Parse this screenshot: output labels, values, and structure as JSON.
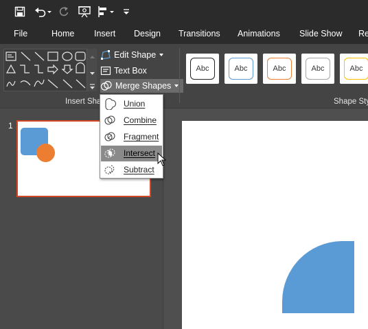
{
  "quick_access": {
    "icons": [
      "save-icon",
      "undo-icon",
      "redo-icon",
      "presentation-from-beginning-icon",
      "align-icon",
      "customize-qat-icon"
    ]
  },
  "tabs": [
    "File",
    "Home",
    "Insert",
    "Design",
    "Transitions",
    "Animations",
    "Slide Show",
    "Re"
  ],
  "ribbon": {
    "edit_shape": "Edit Shape",
    "text_box": "Text Box",
    "merge_shapes": "Merge Shapes",
    "insert_shapes_label": "Insert Sha",
    "shape_styles_label": "Shape Sty",
    "style_sample_text": "Abc",
    "style_colors": [
      "#222222",
      "#5b9bd5",
      "#ed7d31",
      "#a5a5a5",
      "#ffc000"
    ]
  },
  "merge_menu": {
    "items": [
      "Union",
      "Combine",
      "Fragment",
      "Intersect",
      "Subtract"
    ],
    "hovered": "Intersect"
  },
  "slides_pane": {
    "slide_number": "1"
  },
  "colors": {
    "accent_blue": "#5b9bd5",
    "accent_orange": "#ed7d31",
    "selection_border": "#d24726"
  }
}
